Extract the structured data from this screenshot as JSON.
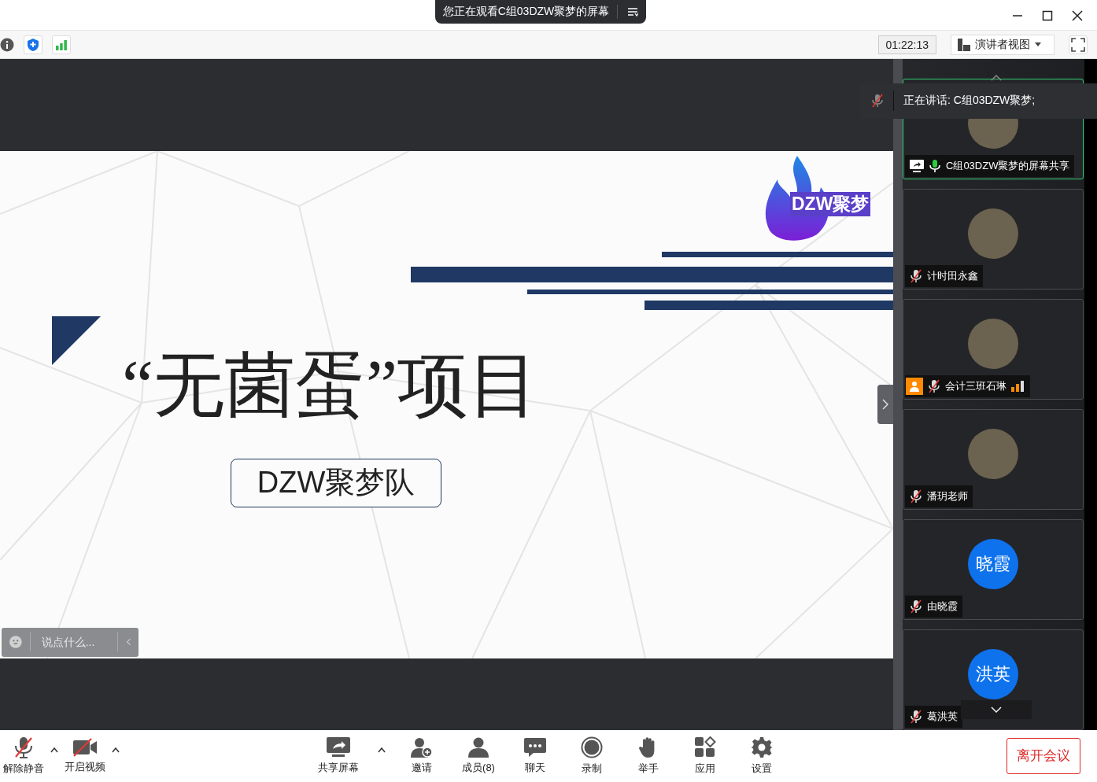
{
  "window": {
    "banner": "您正在观看C组03DZW聚梦的屏幕"
  },
  "info_bar": {
    "timer": "01:22:13",
    "view_mode": "演讲者视图"
  },
  "slide": {
    "logo": "DZW聚梦",
    "title": "“无菌蛋”项目",
    "subtitle": "DZW聚梦队"
  },
  "chat_input": {
    "placeholder": "说点什么..."
  },
  "speaking": {
    "label": "正在讲话: C组03DZW聚梦;"
  },
  "participants": [
    {
      "name": "C组03DZW聚梦的屏幕共享",
      "muted": false,
      "sharing": true,
      "active": true,
      "spotlight_badge": false,
      "signal_bars": false
    },
    {
      "name": "计时田永鑫",
      "muted": true,
      "sharing": false,
      "active": false,
      "spotlight_badge": false,
      "signal_bars": false
    },
    {
      "name": "会计三班石琳",
      "muted": true,
      "sharing": false,
      "active": false,
      "spotlight_badge": true,
      "signal_bars": true
    },
    {
      "name": "潘玥老师",
      "muted": true,
      "sharing": false,
      "active": false,
      "spotlight_badge": false,
      "signal_bars": false
    },
    {
      "name": "由晓霞",
      "initials": "晓霞",
      "muted": true,
      "sharing": false,
      "active": false,
      "spotlight_badge": false,
      "signal_bars": false
    },
    {
      "name": "葛洪英",
      "initials": "洪英",
      "muted": true,
      "sharing": false,
      "active": false,
      "spotlight_badge": false,
      "signal_bars": false
    }
  ],
  "toolbar_left": [
    {
      "kind": "mic",
      "label": "解除静音",
      "caret": true
    },
    {
      "kind": "video",
      "label": "开启视频",
      "caret": true
    }
  ],
  "toolbar_center": [
    {
      "kind": "share",
      "label": "共享屏幕",
      "caret": true
    },
    {
      "kind": "invite",
      "label": "邀请",
      "caret": false
    },
    {
      "kind": "members",
      "label": "成员(8)",
      "caret": false
    },
    {
      "kind": "chat",
      "label": "聊天",
      "caret": false
    },
    {
      "kind": "record",
      "label": "录制",
      "caret": false
    },
    {
      "kind": "hand",
      "label": "举手",
      "caret": false
    },
    {
      "kind": "apps",
      "label": "应用",
      "caret": false
    },
    {
      "kind": "settings",
      "label": "设置",
      "caret": false
    }
  ],
  "leave_button": "离开会议"
}
